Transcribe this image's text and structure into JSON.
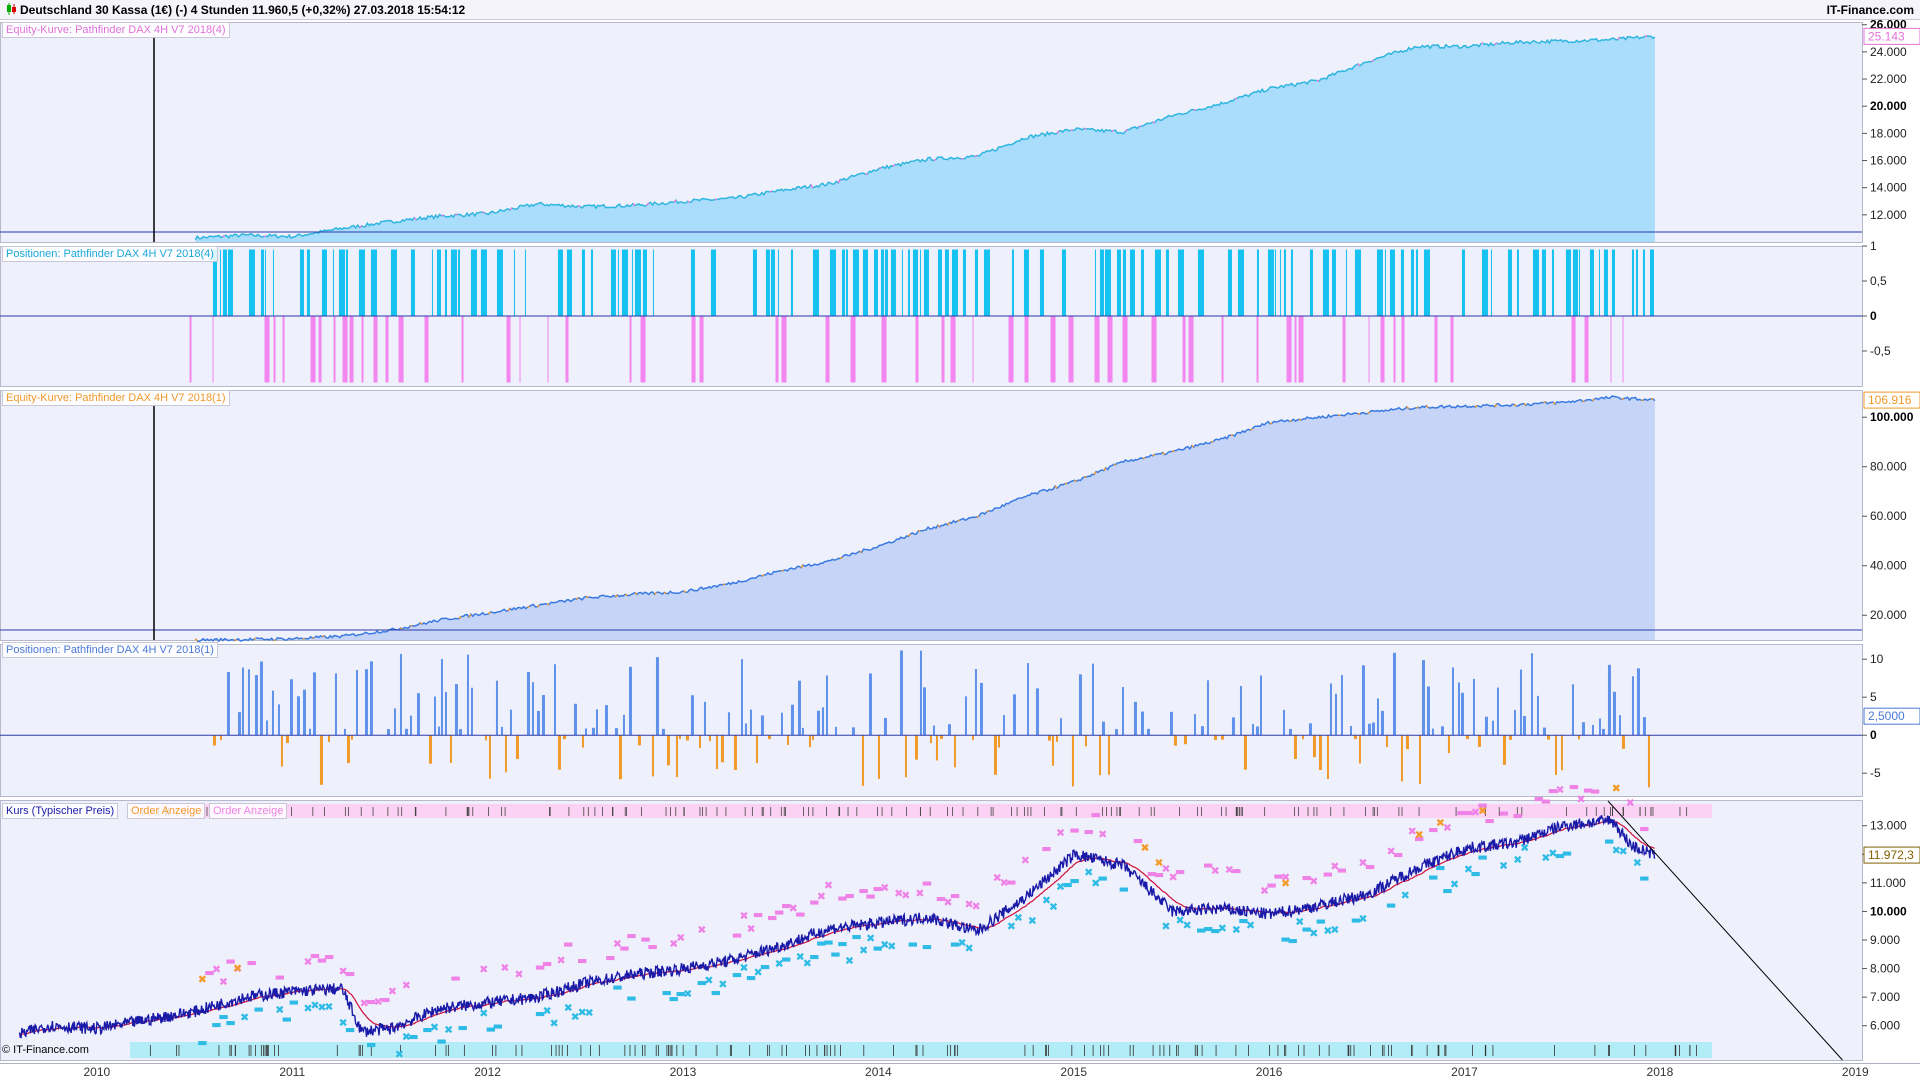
{
  "header": {
    "title": "Deutschland 30 Kassa (1€) (-)  4 Stunden  11.960,5 (+0,32%)  27.03.2018 15:54:12",
    "brand": "IT-Finance.com"
  },
  "copyright": "© IT-Finance.com",
  "x_axis": {
    "labels": [
      "2010",
      "2011",
      "2012",
      "2013",
      "2014",
      "2015",
      "2016",
      "2017",
      "2018",
      "2019"
    ]
  },
  "colors": {
    "panel_bg": "#f0f0fa",
    "equity1_fill": "#aadcfc",
    "equity1_line": "#2fb6de",
    "pos1_long": "#16c2f0",
    "pos1_short": "#f486ef",
    "equity2_fill": "#c6d5f7",
    "equity2_line": "#f09a2a",
    "pos2_long": "#5f92ea",
    "pos2_short": "#f09a2a",
    "price_line": "#1a1aa8",
    "ma_line": "#d0103a",
    "marker_magenta": "#ee82e6",
    "marker_cyan": "#2ebbe6",
    "marker_orange": "#f39a2a",
    "zero_line": "#2a3aa8"
  },
  "chart_data": [
    {
      "type": "area",
      "label": "Equity-Kurve: Pathfinder DAX 4H V7 2018(4)",
      "y_ticks": [
        "26.000",
        "24.000",
        "22.000",
        "20.000",
        "18.000",
        "16.000",
        "14.000",
        "12.000"
      ],
      "ylim": [
        10000,
        26200
      ],
      "last_value": "25.143",
      "x": [
        2010.75,
        2011.0,
        2011.25,
        2011.5,
        2011.75,
        2012.0,
        2012.25,
        2012.5,
        2012.75,
        2013.0,
        2013.25,
        2013.5,
        2013.75,
        2014.0,
        2014.25,
        2014.5,
        2014.75,
        2015.0,
        2015.25,
        2015.5,
        2015.75,
        2016.0,
        2016.25,
        2016.5,
        2016.75,
        2017.0,
        2017.25,
        2017.5,
        2017.75,
        2018.0,
        2018.22
      ],
      "values": [
        10300,
        10500,
        10400,
        11000,
        11500,
        11900,
        12100,
        12800,
        12600,
        12700,
        13000,
        13200,
        13800,
        14300,
        15400,
        16100,
        16300,
        17700,
        18300,
        18100,
        19300,
        20200,
        21300,
        21900,
        23300,
        24400,
        24400,
        24700,
        24800,
        24900,
        25143
      ]
    },
    {
      "type": "bar",
      "label": "Positionen: Pathfinder DAX 4H V7 2018(4)",
      "y_ticks": [
        "1",
        "0,5",
        "0",
        "-0,5"
      ],
      "ylim": [
        -1,
        1
      ]
    },
    {
      "type": "area",
      "label": "Equity-Kurve: Pathfinder DAX 4H V7 2018(1)",
      "y_ticks": [
        "100.000",
        "80.000",
        "60.000",
        "40.000",
        "20.000"
      ],
      "ylim": [
        10000,
        111000
      ],
      "last_value": "106.916",
      "x": [
        2010.75,
        2011.0,
        2011.25,
        2011.5,
        2011.75,
        2012.0,
        2012.25,
        2012.5,
        2012.75,
        2013.0,
        2013.25,
        2013.5,
        2013.75,
        2014.0,
        2014.25,
        2014.5,
        2014.75,
        2015.0,
        2015.25,
        2015.5,
        2015.75,
        2016.0,
        2016.25,
        2016.5,
        2016.75,
        2017.0,
        2017.25,
        2017.5,
        2017.75,
        2018.0,
        2018.22
      ],
      "values": [
        10000,
        10200,
        10500,
        11500,
        14000,
        18000,
        21000,
        24000,
        27000,
        28500,
        29500,
        33000,
        38000,
        42000,
        48000,
        55000,
        60000,
        68000,
        74000,
        82000,
        86000,
        91000,
        98000,
        100000,
        102000,
        104000,
        104500,
        105000,
        106000,
        108000,
        106916
      ]
    },
    {
      "type": "bar",
      "label": "Positionen: Pathfinder DAX 4H V7 2018(1)",
      "y_ticks": [
        "10",
        "5",
        "0",
        "-5"
      ],
      "ylim": [
        -8,
        12
      ],
      "last_value": "2,5000"
    },
    {
      "type": "line",
      "label": "Kurs (Typischer Preis)",
      "legend": [
        "Kurs (Typischer Preis)",
        "Order Anzeige",
        "Order Anzeige"
      ],
      "y_ticks": [
        "13.000",
        "12.000",
        "11.000",
        "10.000",
        "9.000",
        "8.000",
        "7.000",
        "6.000"
      ],
      "ylim": [
        4800,
        13900
      ],
      "last_value": "11.972,3",
      "x": [
        2009.85,
        2010.0,
        2010.25,
        2010.5,
        2010.75,
        2011.0,
        2011.25,
        2011.5,
        2011.6,
        2011.75,
        2012.0,
        2012.25,
        2012.5,
        2012.75,
        2013.0,
        2013.25,
        2013.5,
        2013.75,
        2014.0,
        2014.25,
        2014.5,
        2014.75,
        2015.0,
        2015.25,
        2015.5,
        2015.75,
        2016.0,
        2016.25,
        2016.5,
        2016.75,
        2017.0,
        2017.25,
        2017.5,
        2017.75,
        2018.0,
        2018.1,
        2018.22
      ],
      "values": [
        5700,
        6000,
        5900,
        6200,
        6500,
        7000,
        7200,
        7300,
        5800,
        5900,
        6600,
        6800,
        7000,
        7500,
        7800,
        8000,
        8300,
        8800,
        9400,
        9600,
        9800,
        9300,
        10500,
        12000,
        11600,
        10000,
        10100,
        9900,
        10200,
        10600,
        11500,
        12200,
        12400,
        13000,
        13200,
        12300,
        11972
      ]
    }
  ]
}
